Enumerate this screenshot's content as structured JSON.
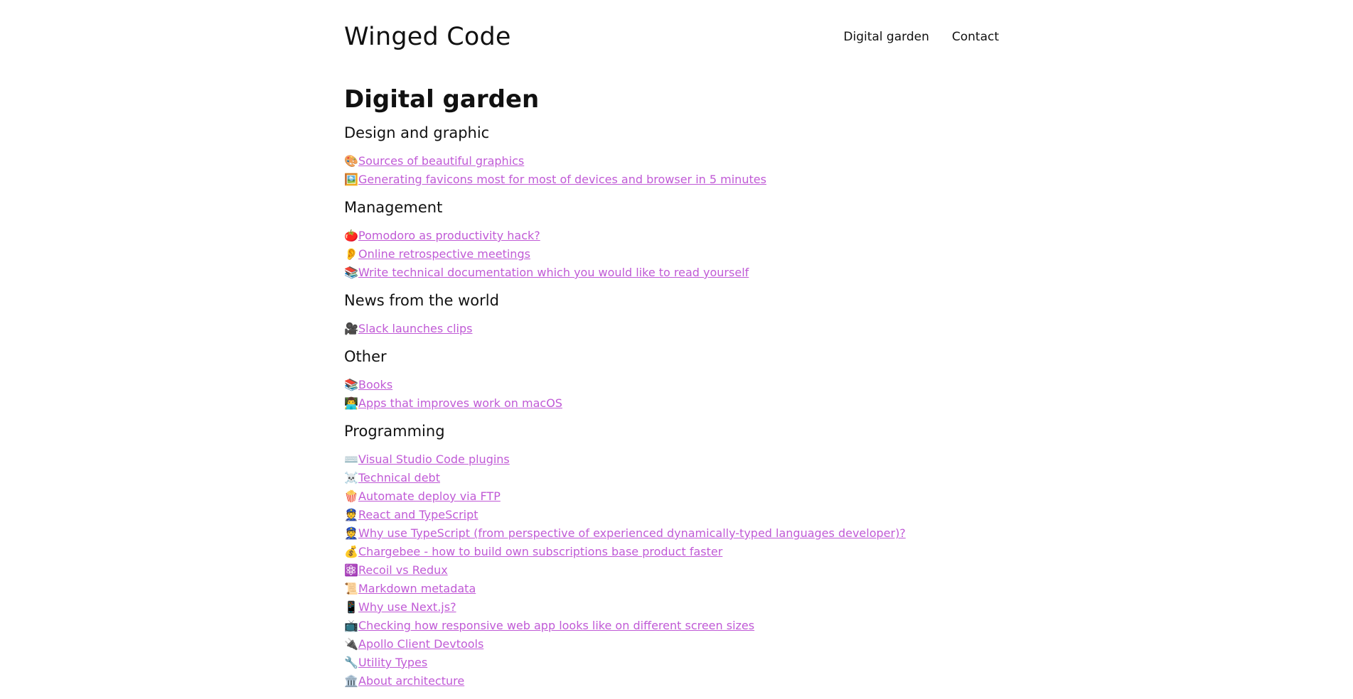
{
  "header": {
    "site_title": "Winged Code",
    "nav": [
      {
        "label": "Digital garden"
      },
      {
        "label": "Contact"
      }
    ]
  },
  "main": {
    "page_title": "Digital garden",
    "sections": [
      {
        "title": "Design and graphic",
        "links": [
          {
            "emoji": "🎨",
            "label": "Sources of beautiful graphics"
          },
          {
            "emoji": "🖼️",
            "label": "Generating favicons most for most of devices and browser in 5 minutes"
          }
        ]
      },
      {
        "title": "Management",
        "links": [
          {
            "emoji": "🍅",
            "label": "Pomodoro as productivity hack?"
          },
          {
            "emoji": "👂",
            "label": "Online retrospective meetings"
          },
          {
            "emoji": "📚",
            "label": "Write technical documentation which you would like to read yourself"
          }
        ]
      },
      {
        "title": "News from the world",
        "links": [
          {
            "emoji": "🎥",
            "label": "Slack launches clips"
          }
        ]
      },
      {
        "title": "Other",
        "links": [
          {
            "emoji": "📚",
            "label": "Books"
          },
          {
            "emoji": "👨‍💻",
            "label": "Apps that improves work on macOS"
          }
        ]
      },
      {
        "title": "Programming",
        "links": [
          {
            "emoji": "⌨️",
            "label": "Visual Studio Code plugins"
          },
          {
            "emoji": "☠️",
            "label": "Technical debt"
          },
          {
            "emoji": "🍿",
            "label": "Automate deploy via FTP"
          },
          {
            "emoji": "👮",
            "label": "React and TypeScript"
          },
          {
            "emoji": "👮",
            "label": "Why use TypeScript (from perspective of experienced dynamically-typed languages developer)?"
          },
          {
            "emoji": "💰",
            "label": "Chargebee - how to build own subscriptions base product faster"
          },
          {
            "emoji": "⚛️",
            "label": "Recoil vs Redux"
          },
          {
            "emoji": "📜",
            "label": "Markdown metadata"
          },
          {
            "emoji": "📱",
            "label": "Why use Next.js?"
          },
          {
            "emoji": "📺",
            "label": "Checking how responsive web app looks like on different screen sizes"
          },
          {
            "emoji": "🔌",
            "label": "Apollo Client Devtools"
          },
          {
            "emoji": "🔧",
            "label": "Utility Types"
          },
          {
            "emoji": "🏛️",
            "label": "About architecture"
          }
        ]
      }
    ]
  },
  "colors": {
    "link": "#c05ad6",
    "text": "#111111",
    "background": "#ffffff"
  }
}
